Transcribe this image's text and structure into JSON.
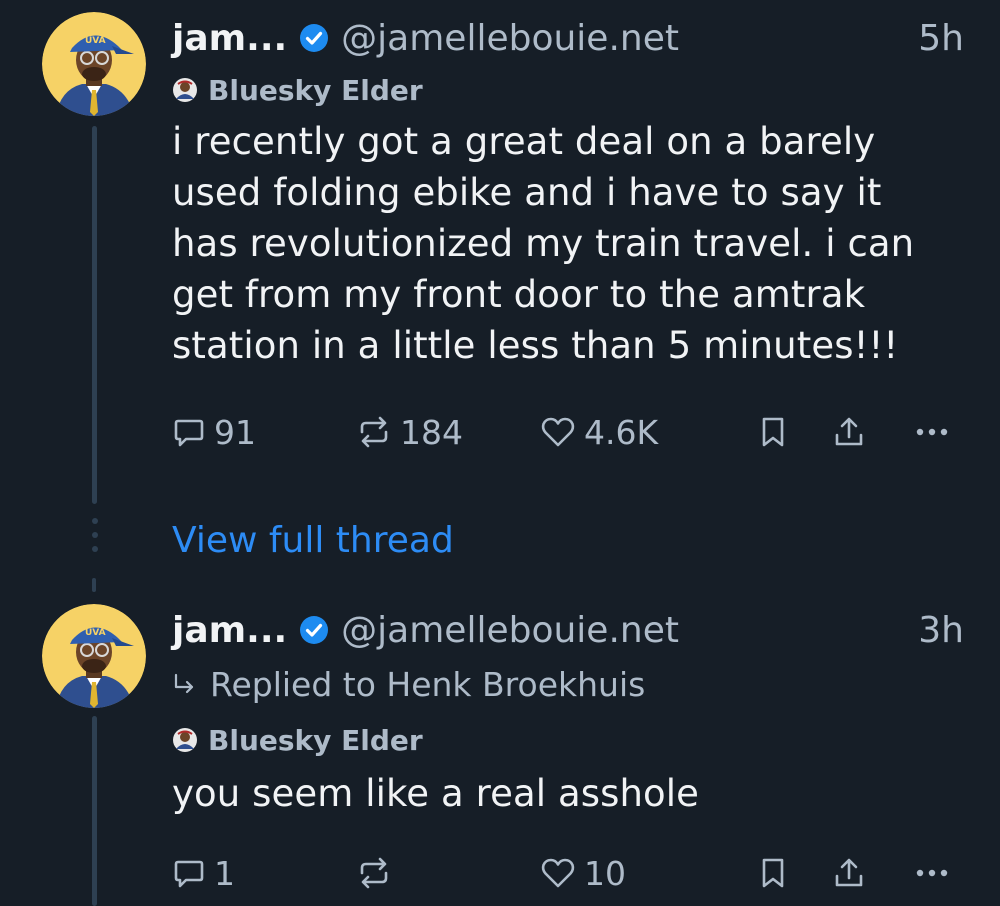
{
  "posts": [
    {
      "author_name": "jam...",
      "handle": "@jamellebouie.net",
      "time": "5h",
      "badge": "Bluesky Elder",
      "text": "i recently got a great deal on a barely used folding ebike and i have to say it has revolutionized my train travel. i can get from my front door to the amtrak station in a little less than 5 minutes!!!",
      "replies": "91",
      "reposts": "184",
      "likes": "4.6K"
    },
    {
      "author_name": "jam...",
      "handle": "@jamellebouie.net",
      "time": "3h",
      "replied_to": "Replied to Henk Broekhuis",
      "badge": "Bluesky Elder",
      "text": "you seem like a real asshole",
      "replies": "1",
      "reposts": "",
      "likes": "10"
    }
  ],
  "thread": {
    "view_full_thread": "View full thread"
  },
  "colors": {
    "background": "#161e27",
    "text": "#f1f3f5",
    "muted": "#aebbc9",
    "link": "#2d8cf5",
    "verified": "#1d8bf0",
    "thread_line": "#2e4052"
  }
}
